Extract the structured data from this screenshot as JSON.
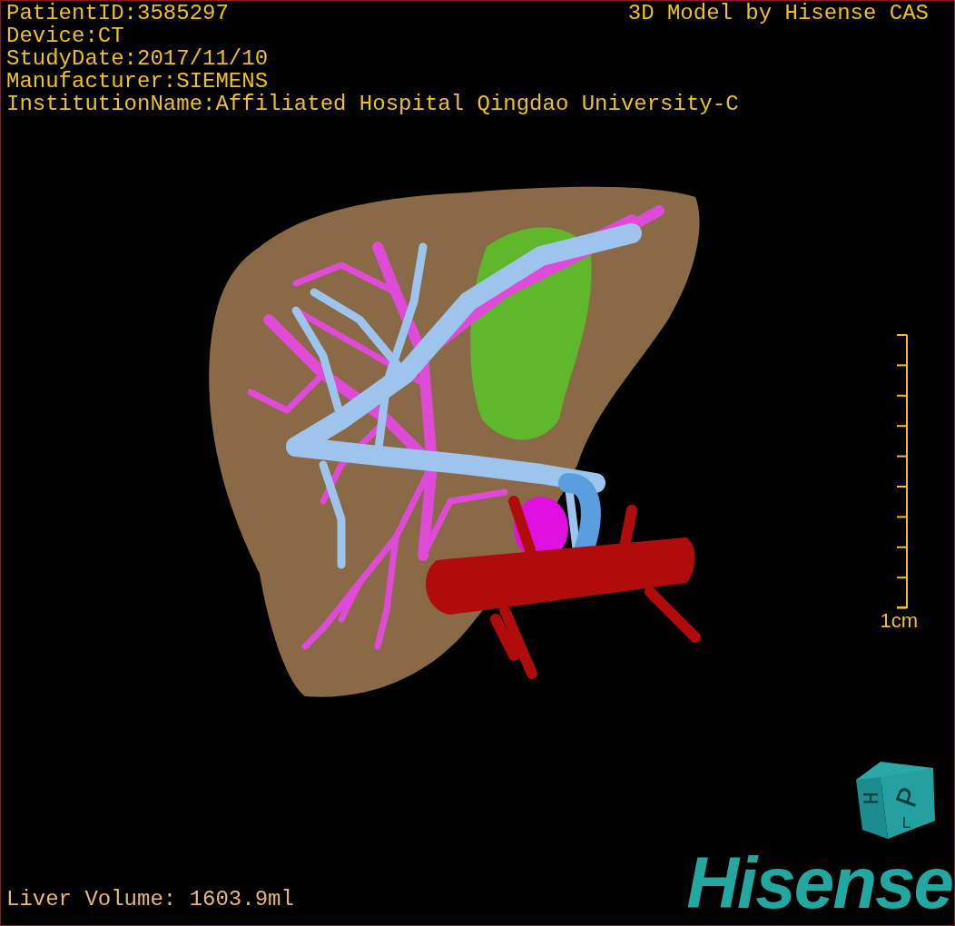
{
  "patient_info": [
    "PatientID:3585297",
    "Device:CT",
    "StudyDate:2017/11/10",
    "Manufacturer:SIEMENS",
    "InstitutionName:Affiliated Hospital Qingdao University-C"
  ],
  "title": "3D Model by Hisense CAS",
  "scale_bar": {
    "label": "1cm"
  },
  "liver_volume": "Liver Volume: 1603.9ml",
  "orientation_cube": {
    "labels": [
      "H",
      "P",
      "L"
    ]
  },
  "logo": "Hisense"
}
